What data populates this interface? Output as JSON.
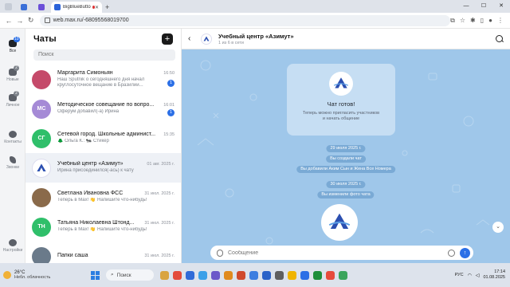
{
  "browser": {
    "tabs": [
      {
        "label": "",
        "color": "#3a6fd8"
      },
      {
        "label": "",
        "color": "#6b4fd8"
      },
      {
        "label": "BigBlueButton - Акимов Па",
        "color": "#2b63d9",
        "active": true
      }
    ],
    "url": "web.max.ru/-68095568019700"
  },
  "rail": {
    "items": [
      {
        "label": "Все",
        "badge": "10"
      },
      {
        "label": "Новые",
        "badge": "2"
      },
      {
        "label": "Личное",
        "badge": "2"
      },
      {
        "label": "Контакты",
        "badge": ""
      },
      {
        "label": "Звонки",
        "badge": ""
      },
      {
        "label": "Настройки",
        "badge": ""
      }
    ]
  },
  "chatlist": {
    "title": "Чаты",
    "search_placeholder": "Поиск",
    "chats": [
      {
        "name": "Маргарита Симоньян",
        "time": "16:50",
        "preview": "Наш Sputnik о сегодняшнего дня начал круглосуточное вещание в Бразилии...",
        "unread": "1",
        "avatar": "",
        "color": "#c54a6a"
      },
      {
        "name": "Методическое совещание по вопро...",
        "time": "16:01",
        "preview": "Оферум добавил(-а) Ирина",
        "unread": "1",
        "avatar": "МС",
        "color": "#a58ad6"
      },
      {
        "name": "Сетевой город. Школьные админист...",
        "time": "15:35",
        "preview": "🌲 Ольга К.: 🐜 Стикер",
        "unread": "",
        "avatar": "СГ",
        "color": "#2fbf6a"
      },
      {
        "name": "Учебный центр «Азимут»",
        "time": "01 авг. 2025 г.",
        "preview": "Ирина присоединился(-ась) к чату",
        "unread": "",
        "avatar": "",
        "color": "#ffffff",
        "selected": true
      },
      {
        "name": "Светлана Ивановна ФСС",
        "time": "31 июл. 2025 г.",
        "preview": "Теперь в Max! 👋 Напишите что-нибудь!",
        "unread": "",
        "avatar": "",
        "color": "#8a6a4a"
      },
      {
        "name": "Татьяна Николаевна Штонд...",
        "time": "31 июл. 2025 г.",
        "preview": "Теперь в Max! 👋 Напишите что-нибудь!",
        "unread": "",
        "avatar": "ТН",
        "color": "#2fbf6a"
      },
      {
        "name": "Папки саша",
        "time": "31 июл. 2025 г.",
        "preview": "",
        "unread": "",
        "avatar": "",
        "color": "#6a7a8a"
      }
    ]
  },
  "conversation": {
    "title": "Учебный центр «Азимут»",
    "subtitle": "1 из 6 в сети",
    "ready_title": "Чат готов!",
    "ready_desc": "Теперь можно пригласить участников и начать общение",
    "events": [
      "29 июля 2025 г.",
      "Вы создали чат",
      "Вы добавили Аким Сын и Жена Все Номера",
      "30 июля 2025 г.",
      "Вы изменили фото чата"
    ],
    "composer_placeholder": "Сообщение"
  },
  "taskbar": {
    "weather_temp": "26°C",
    "weather_desc": "Небл. облачность",
    "search": "Поиск",
    "lang": "РУС",
    "time": "17:14",
    "date": "01.08.2025"
  },
  "colors": {
    "accent": "#2b6fe6",
    "chat_bg": "#9fc7ea"
  }
}
